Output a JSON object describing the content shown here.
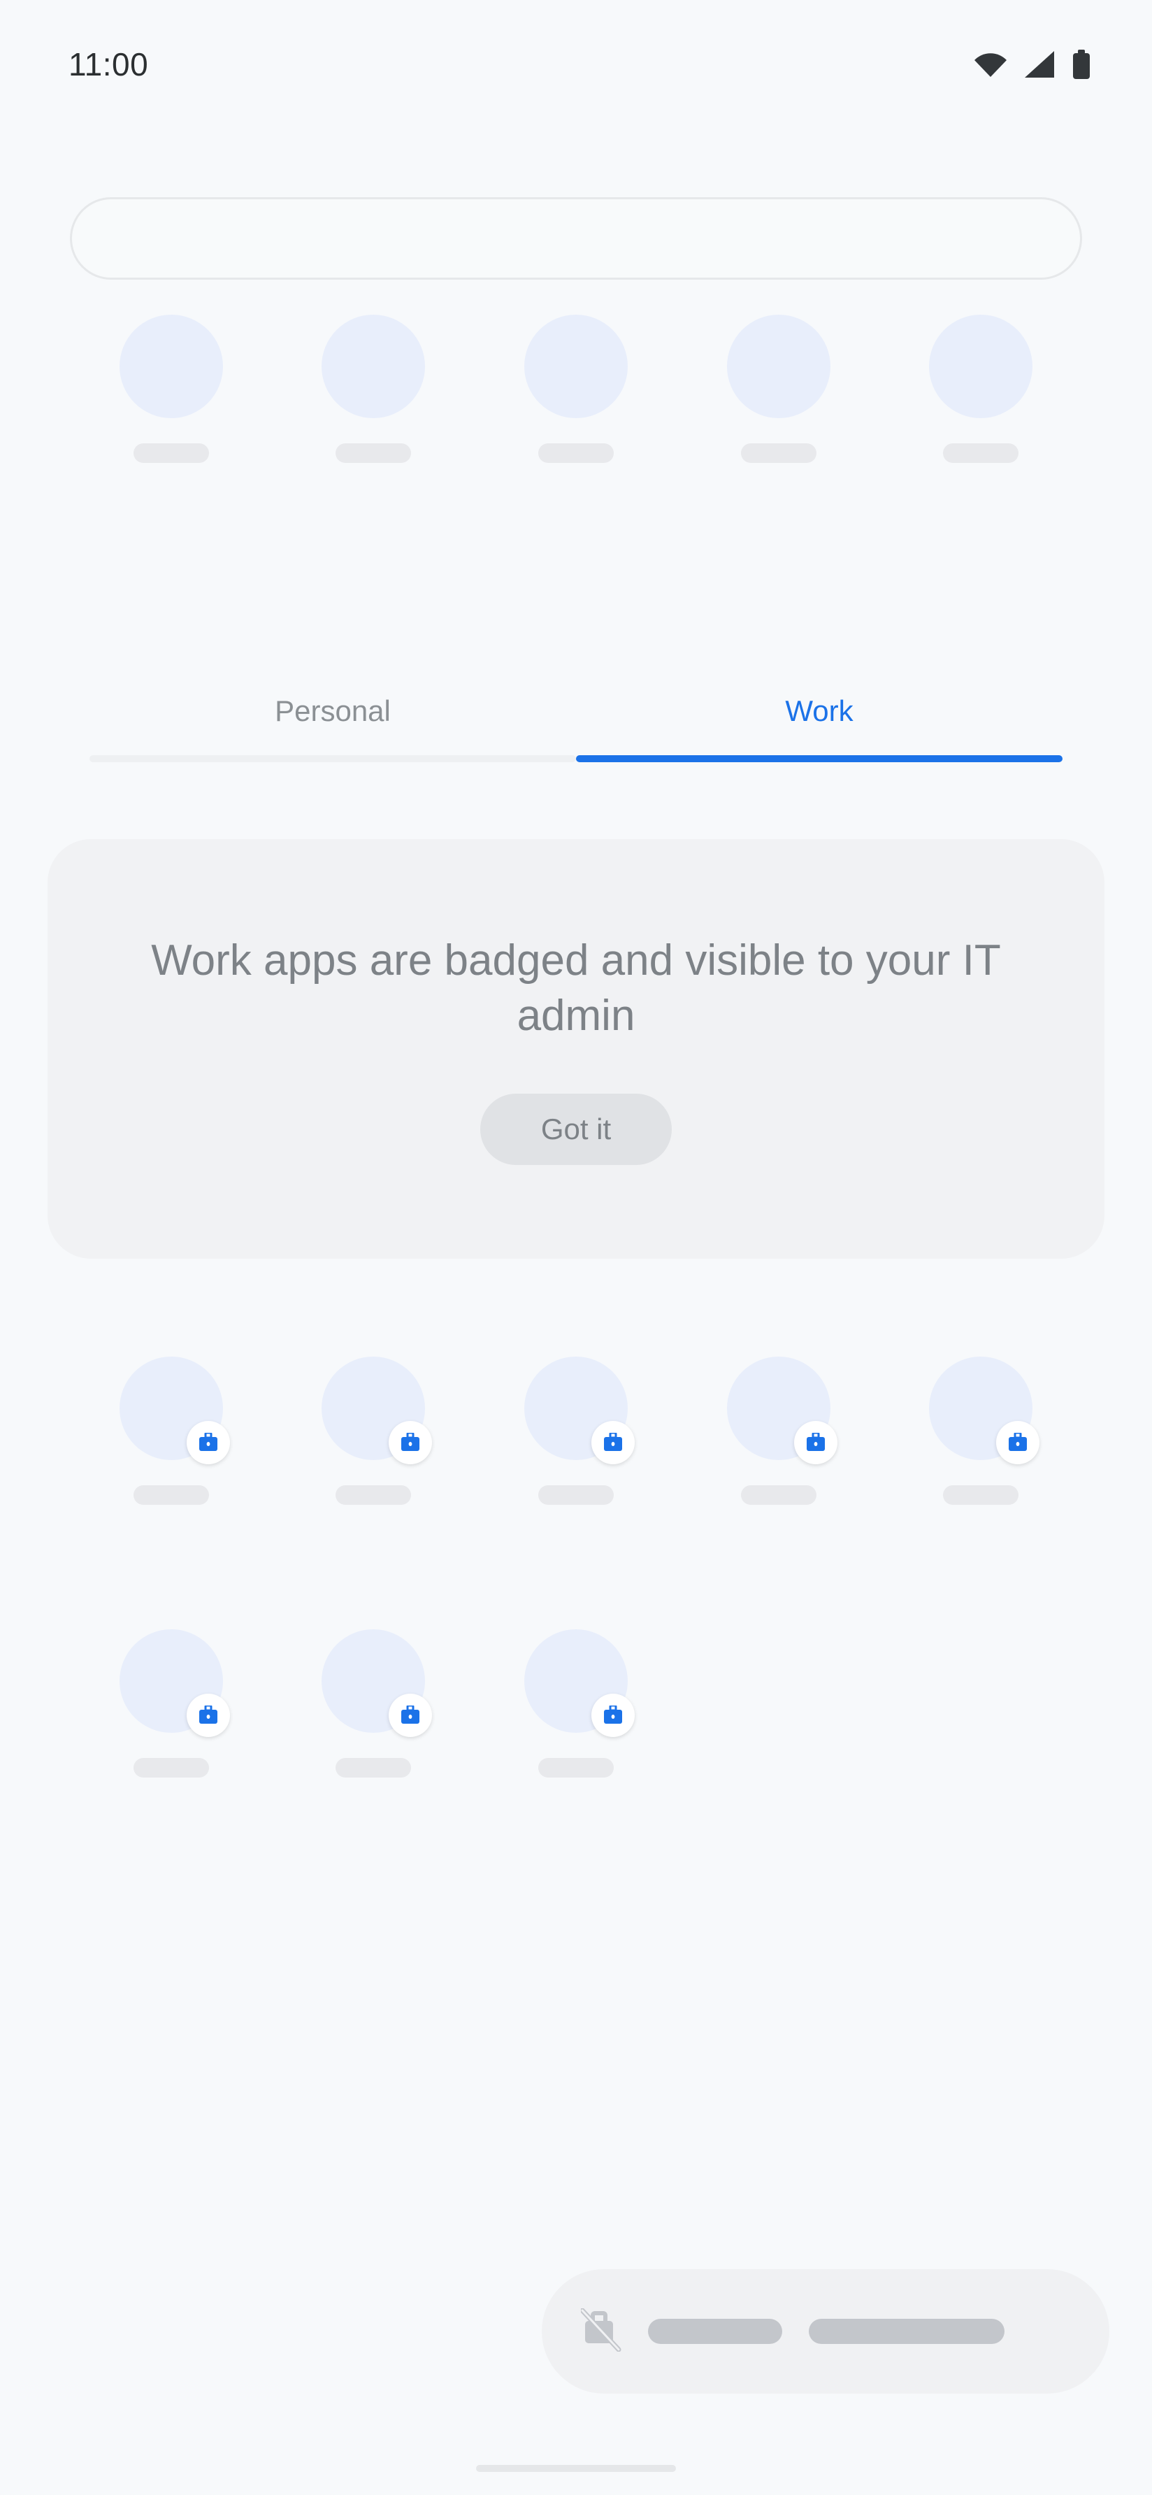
{
  "status_bar": {
    "time": "11:00",
    "icons": [
      {
        "name": "wifi-icon",
        "label": "Wi-Fi"
      },
      {
        "name": "cellular-signal-icon",
        "label": "Mobile signal"
      },
      {
        "name": "battery-icon",
        "label": "Battery"
      }
    ]
  },
  "search": {
    "value": "",
    "placeholder": ""
  },
  "tabs": {
    "personal_label": "Personal",
    "work_label": "Work",
    "selected": "Work",
    "active_color": "#1b72e8",
    "inactive_color": "#8b9094"
  },
  "info_card": {
    "message": "Work apps are badged and visible to your IT admin",
    "button_label": "Got it",
    "background_color": "#f1f2f4",
    "text_color": "#7d8287"
  },
  "app_rows": {
    "suggestions": {
      "count": 5,
      "badged": false
    },
    "work_row_1": {
      "count": 5,
      "badged": true
    },
    "work_row_2": {
      "count": 3,
      "badged": true
    },
    "icon_placeholder_color": "#e8eefb",
    "label_placeholder_color": "#e8e9ec",
    "badge_icon": "work-briefcase-icon",
    "badge_color": "#1b72e8"
  },
  "bottom_bar": {
    "icon": "work-profile-off-icon",
    "pill_count": 2,
    "background_color": "#f0f1f3",
    "pill_color": "#c3c6cb"
  },
  "home_indicator": {
    "name": "home-gesture-indicator"
  }
}
